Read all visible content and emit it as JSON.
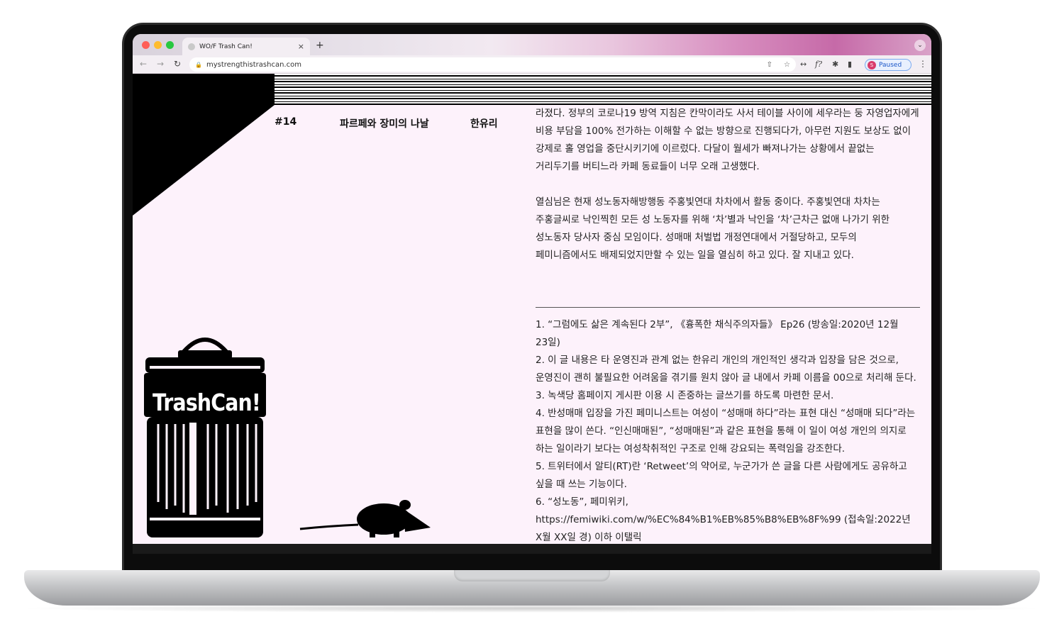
{
  "browser": {
    "tab_title": "WO/F Trash Can!",
    "new_tab_glyph": "+",
    "tab_close_glyph": "×",
    "url": "mystrengthistrashcan.com",
    "profile_initial": "S",
    "profile_status": "Paused"
  },
  "page": {
    "issue_number": "#14",
    "article_title": "파르페와 장미의 나날",
    "author": "한유리",
    "paragraphs": [
      "라졌다. 정부의 코로나19 방역 지침은 칸막이라도 사서 테이블 사이에 세우라는 둥 자영업자에게 비용 부담을 100% 전가하는 이해할 수 없는 방향으로 진행되다가, 아무런 지원도 보상도 없이 강제로 홀 영업을 중단시키기에 이르렀다. 다달이 월세가 빠져나가는 상황에서 끝없는 거리두기를 버티느라 카페 동료들이 너무 오래 고생했다.",
      "열심님은 현재 성노동자해방행동 주홍빛연대 차차에서 활동 중이다. 주홍빛연대 차차는 주홍글씨로 낙인찍힌 모든 성 노동자를 위해 ‘차’별과 낙인을 ‘차’근차근 없애 나가기 위한 성노동자 당사자 중심 모임이다. 성매매 처벌법 개정연대에서 거절당하고, 모두의 페미니즘에서도 배제되었지만할 수 있는 일을 열심히 하고 있다. 잘 지내고 있다."
    ],
    "footnotes": [
      "1.   “그럼에도 삶은 계속된다 2부”, 《흉폭한 채식주의자들》 Ep26 (방송일:2020년 12월 23일)",
      "2.   이 글 내용은 타 운영진과 관계 없는 한유리 개인의 개인적인 생각과 입장을 담은 것으로, 운영진이 괜히 불필요한 어려움을 겪기를 원치 않아 글 내에서 카페 이름을 00으로 처리해 둔다.",
      "3. 녹색당 홈페이지 게시판 이용 시 존중하는 글쓰기를 하도록 마련한 문서.",
      "4. 반성매매 입장을 가진 페미니스트는 여성이 “성매매 하다”라는 표현 대신 “성매매 되다”라는 표현을 많이 쓴다. “인신매매된”, “성매매된”과 같은 표현을 통해 이 일이 여성 개인의 의지로 하는 일이라기 보다는 여성착취적인 구조로 인해 강요되는 폭력임을 강조한다.",
      "5. 트위터에서 알티(RT)란 ‘Retweet’의 약어로, 누군가가 쓴 글을 다른 사람에게도 공유하고 싶을 때 쓰는 기능이다.",
      "6. “성노동”, 페미위키, https://femiwiki.com/w/%EC%84%B1%EB%85%B8%EB%8F%99 (접속일:2022년 X월 XX일 경) 이하 이탤릭"
    ],
    "logo_text": "TrashCan!"
  }
}
